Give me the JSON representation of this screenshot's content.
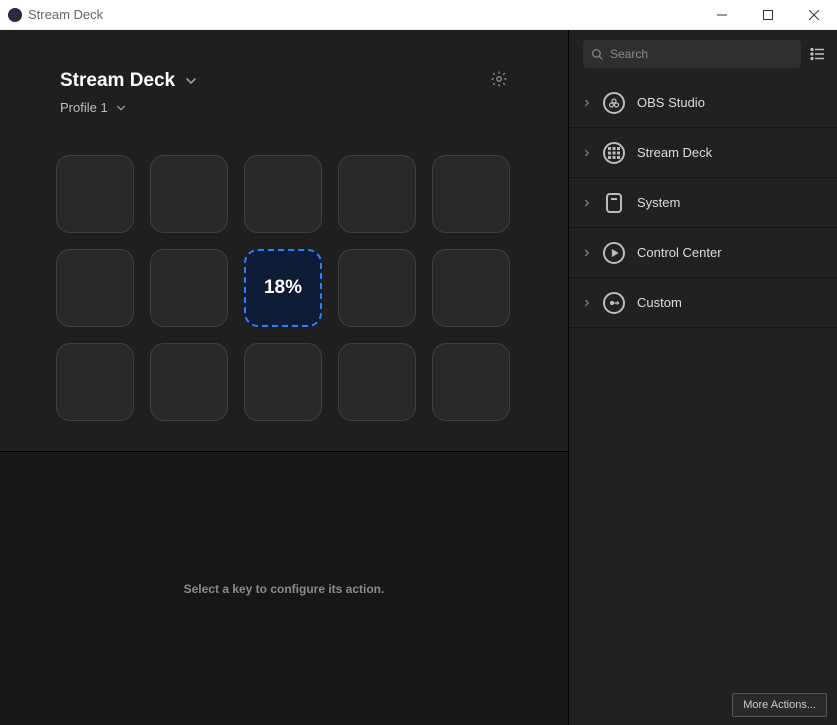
{
  "window": {
    "title": "Stream Deck"
  },
  "device": {
    "name": "Stream Deck"
  },
  "profile": {
    "name": "Profile 1"
  },
  "grid": {
    "keys": [
      {
        "filled": false
      },
      {
        "filled": false
      },
      {
        "filled": false
      },
      {
        "filled": false
      },
      {
        "filled": false
      },
      {
        "filled": false
      },
      {
        "filled": false
      },
      {
        "filled": true,
        "label": "18%"
      },
      {
        "filled": false
      },
      {
        "filled": false
      },
      {
        "filled": false
      },
      {
        "filled": false
      },
      {
        "filled": false
      },
      {
        "filled": false
      },
      {
        "filled": false
      }
    ]
  },
  "config": {
    "hint": "Select a key to configure its action."
  },
  "search": {
    "placeholder": "Search"
  },
  "categories": [
    {
      "name": "OBS Studio",
      "icon": "obs"
    },
    {
      "name": "Stream Deck",
      "icon": "grid"
    },
    {
      "name": "System",
      "icon": "system"
    },
    {
      "name": "Control Center",
      "icon": "control"
    },
    {
      "name": "Custom",
      "icon": "custom"
    }
  ],
  "footer": {
    "more_actions": "More Actions..."
  }
}
